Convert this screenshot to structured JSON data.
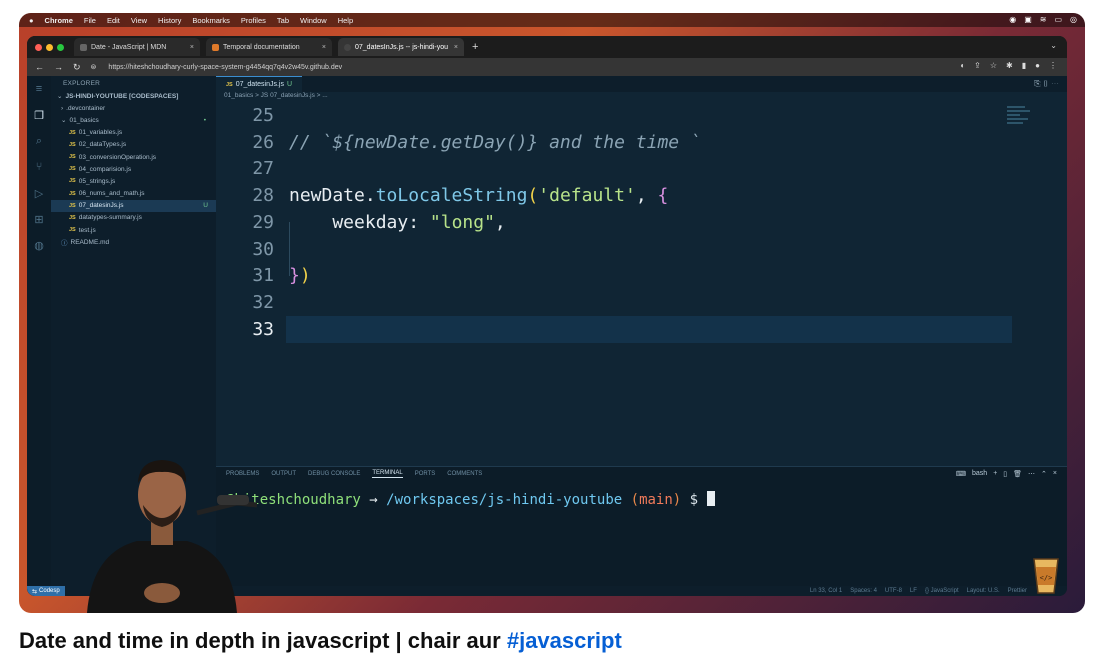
{
  "mac_menu": [
    "Chrome",
    "File",
    "Edit",
    "View",
    "History",
    "Bookmarks",
    "Profiles",
    "Tab",
    "Window",
    "Help"
  ],
  "browser": {
    "tabs": [
      {
        "title": "Date - JavaScript | MDN",
        "active": false
      },
      {
        "title": "Temporal documentation",
        "active": false
      },
      {
        "title": "07_datesInJs.js -- js-hindi-you",
        "active": true
      }
    ],
    "new_tab": "+",
    "url": "https://hiteshchoudhary-curly-space-system-g4454qq7q4v2w45v.github.dev"
  },
  "explorer": {
    "header": "EXPLORER",
    "root": "JS-HINDI-YOUTUBE [CODESPACES]",
    "items": [
      {
        "label": ".devcontainer",
        "type": "folder",
        "indent": 1
      },
      {
        "label": "01_basics",
        "type": "folder-open",
        "indent": 1
      },
      {
        "label": "01_variables.js",
        "type": "js",
        "indent": 2
      },
      {
        "label": "02_dataTypes.js",
        "type": "js",
        "indent": 2
      },
      {
        "label": "03_conversionOperation.js",
        "type": "js",
        "indent": 2
      },
      {
        "label": "04_comparision.js",
        "type": "js",
        "indent": 2
      },
      {
        "label": "05_strings.js",
        "type": "js",
        "indent": 2
      },
      {
        "label": "06_nums_and_math.js",
        "type": "js",
        "indent": 2
      },
      {
        "label": "07_datesinJs.js",
        "type": "js",
        "indent": 2,
        "active": true,
        "badge": "U"
      },
      {
        "label": "datatypes-summary.js",
        "type": "js",
        "indent": 2
      },
      {
        "label": "test.js",
        "type": "js",
        "indent": 2
      },
      {
        "label": "README.md",
        "type": "info",
        "indent": 1
      }
    ]
  },
  "editor": {
    "tab_label": "07_datesinJs.js",
    "tab_badge": "U",
    "breadcrumb": "01_basics > JS 07_datesinJs.js > ...",
    "current_line": 33
  },
  "code_lines": [
    {
      "n": 25,
      "tokens": []
    },
    {
      "n": 26,
      "tokens": [
        {
          "t": "// `${newDate.getDay()} and the time `",
          "c": "c-comment"
        }
      ]
    },
    {
      "n": 27,
      "tokens": []
    },
    {
      "n": 28,
      "tokens": [
        {
          "t": "newDate",
          "c": "c-ident"
        },
        {
          "t": ".",
          "c": "c-ident"
        },
        {
          "t": "toLocaleString",
          "c": "c-fn"
        },
        {
          "t": "(",
          "c": "c-brace"
        },
        {
          "t": "'default'",
          "c": "c-str"
        },
        {
          "t": ", ",
          "c": "c-ident"
        },
        {
          "t": "{",
          "c": "c-brace2"
        }
      ]
    },
    {
      "n": 29,
      "tokens": [
        {
          "t": "    weekday: ",
          "c": "c-ident"
        },
        {
          "t": "\"long\"",
          "c": "c-str"
        },
        {
          "t": ",",
          "c": "c-ident"
        }
      ]
    },
    {
      "n": 30,
      "tokens": []
    },
    {
      "n": 31,
      "tokens": [
        {
          "t": "}",
          "c": "c-brace2"
        },
        {
          "t": ")",
          "c": "c-brace"
        }
      ]
    },
    {
      "n": 32,
      "tokens": []
    },
    {
      "n": 33,
      "tokens": []
    }
  ],
  "panel": {
    "tabs": [
      "PROBLEMS",
      "OUTPUT",
      "DEBUG CONSOLE",
      "TERMINAL",
      "PORTS",
      "COMMENTS"
    ],
    "active_tab": "TERMINAL",
    "shell": "bash",
    "terminal": {
      "user": "@hiteshchoudhary",
      "arrow": "→",
      "path": "/workspaces/js-hindi-youtube",
      "branch": "main",
      "prompt": "$"
    }
  },
  "statusbar": {
    "remote": "Codesp",
    "items": [
      "Ln 33, Col 1",
      "Spaces: 4",
      "UTF-8",
      "LF",
      "{} JavaScript",
      "Layout: U.S.",
      "Prettier"
    ]
  },
  "video_title": {
    "text": "Date and time in depth in javascript | chair aur ",
    "hashtag": "#javascript"
  },
  "colors": {
    "accent": "#065fd4",
    "editor_bg": "#102534",
    "terminal_user": "#8fe07a",
    "terminal_path": "#6fc8f0"
  }
}
